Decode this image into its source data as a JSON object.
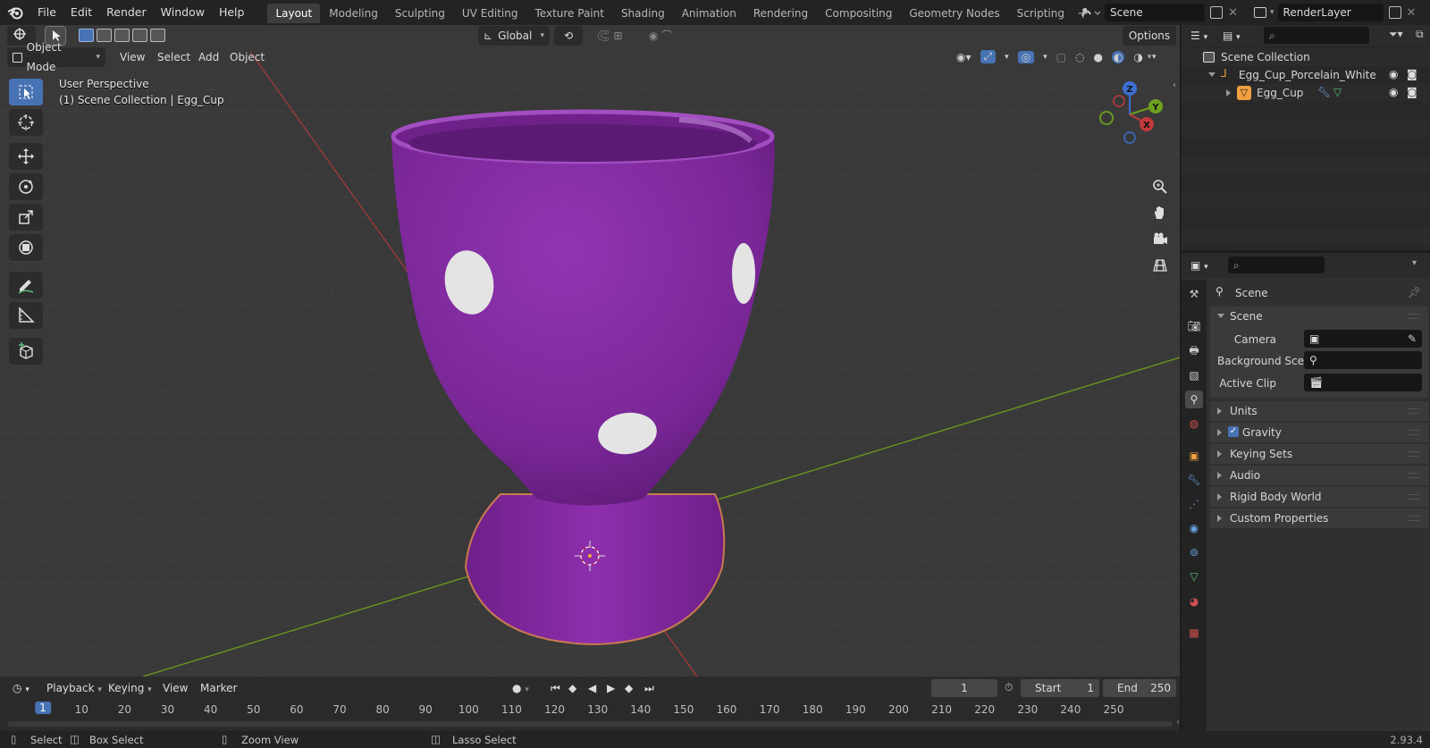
{
  "menu": {
    "file": "File",
    "edit": "Edit",
    "render": "Render",
    "window": "Window",
    "help": "Help"
  },
  "workspaces": [
    "Layout",
    "Modeling",
    "Sculpting",
    "UV Editing",
    "Texture Paint",
    "Shading",
    "Animation",
    "Rendering",
    "Compositing",
    "Geometry Nodes",
    "Scripting"
  ],
  "scene_selector": {
    "value": "Scene"
  },
  "layer_selector": {
    "value": "RenderLayer"
  },
  "viewport": {
    "mode": "Object Mode",
    "menus": {
      "view": "View",
      "select": "Select",
      "add": "Add",
      "object": "Object"
    },
    "orientation": "Global",
    "options": "Options",
    "info_line1": "User Perspective",
    "info_line2": "(1) Scene Collection | Egg_Cup",
    "gizmo": {
      "z": "Z",
      "y": "Y",
      "x": "X"
    }
  },
  "outliner": {
    "root": "Scene Collection",
    "items": [
      {
        "label": "Egg_Cup_Porcelain_White"
      },
      {
        "label": "Egg_Cup"
      }
    ]
  },
  "properties": {
    "context": "Scene",
    "panel": "Scene",
    "fields": {
      "camera": "Camera",
      "background": "Background Sce...",
      "active_clip": "Active Clip"
    },
    "sections": {
      "units": "Units",
      "gravity": "Gravity",
      "keying_sets": "Keying Sets",
      "audio": "Audio",
      "rigid_body": "Rigid Body World",
      "custom": "Custom Properties"
    }
  },
  "timeline": {
    "menus": {
      "playback": "Playback",
      "keying": "Keying",
      "view": "View",
      "marker": "Marker"
    },
    "current_frame": "1",
    "start_label": "Start",
    "start": "1",
    "end_label": "End",
    "end": "250",
    "ruler": [
      "1",
      "10",
      "20",
      "30",
      "40",
      "50",
      "60",
      "70",
      "80",
      "90",
      "100",
      "110",
      "120",
      "130",
      "140",
      "150",
      "160",
      "170",
      "180",
      "190",
      "200",
      "210",
      "220",
      "230",
      "240",
      "250"
    ]
  },
  "status": {
    "select": "Select",
    "box_select": "Box Select",
    "zoom_view": "Zoom View",
    "lasso_select": "Lasso Select",
    "version": "2.93.4"
  },
  "colors": {
    "accent": "#4772b3",
    "cup": "#7e2d9c",
    "x_axis": "#b33b3b",
    "y_axis": "#6b9b1e"
  }
}
